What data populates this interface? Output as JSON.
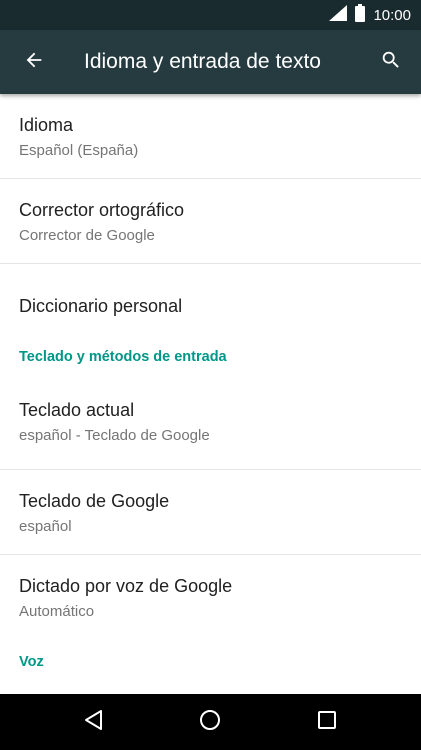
{
  "status_bar": {
    "time": "10:00",
    "icons": [
      "signal-icon",
      "battery-icon"
    ]
  },
  "toolbar": {
    "title": "Idioma y entrada de texto",
    "back_icon": "back-arrow-icon",
    "search_icon": "search-icon",
    "color": "#263b40"
  },
  "preferences": {
    "language": {
      "title": "Idioma",
      "summary": "Español (España)"
    },
    "spell_checker": {
      "title": "Corrector ortográfico",
      "summary": "Corrector de Google"
    },
    "personal_dictionary": {
      "title": "Diccionario personal"
    },
    "keyboard_category": {
      "title": "Teclado y métodos de entrada"
    },
    "current_keyboard": {
      "title": "Teclado actual",
      "summary": "español - Teclado de Google"
    },
    "google_keyboard": {
      "title": "Teclado de Google",
      "summary": "español"
    },
    "google_voice_typing": {
      "title": "Dictado por voz de Google",
      "summary": "Automático"
    },
    "voice_category": {
      "title": "Voz"
    }
  },
  "accent_color": "#009688",
  "nav_bar": {
    "icons": [
      "back-triangle-icon",
      "home-circle-icon",
      "recents-square-icon"
    ]
  }
}
